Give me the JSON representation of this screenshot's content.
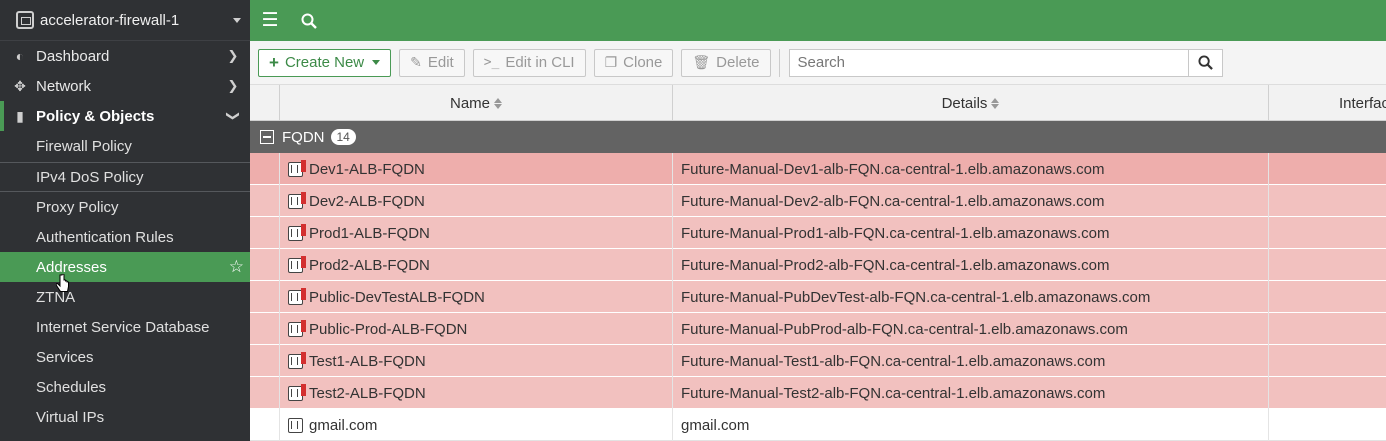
{
  "device": {
    "name": "accelerator-firewall-1"
  },
  "nav": [
    {
      "label": "Dashboard",
      "icon": "dashboard-icon"
    },
    {
      "label": "Network",
      "icon": "network-icon"
    },
    {
      "label": "Policy & Objects",
      "icon": "policy-icon"
    }
  ],
  "subnav": [
    {
      "label": "Firewall Policy"
    },
    {
      "label": "IPv4 DoS Policy"
    },
    {
      "label": "Proxy Policy"
    },
    {
      "label": "Authentication Rules"
    },
    {
      "label": "Addresses"
    },
    {
      "label": "ZTNA"
    },
    {
      "label": "Internet Service Database"
    },
    {
      "label": "Services"
    },
    {
      "label": "Schedules"
    },
    {
      "label": "Virtual IPs"
    }
  ],
  "toolbar": {
    "create_new": "Create New",
    "edit": "Edit",
    "edit_cli": "Edit in CLI",
    "clone": "Clone",
    "delete": "Delete",
    "search_placeholder": "Search"
  },
  "table": {
    "columns": [
      "Name",
      "Details",
      "Interfac"
    ],
    "group": {
      "label": "FQDN",
      "count": "14"
    },
    "rows": [
      {
        "name": "Dev1-ALB-FQDN",
        "details": "Future-Manual-Dev1-alb-FQN.ca-central-1.elb.amazonaws.com"
      },
      {
        "name": "Dev2-ALB-FQDN",
        "details": "Future-Manual-Dev2-alb-FQN.ca-central-1.elb.amazonaws.com"
      },
      {
        "name": "Prod1-ALB-FQDN",
        "details": "Future-Manual-Prod1-alb-FQN.ca-central-1.elb.amazonaws.com"
      },
      {
        "name": "Prod2-ALB-FQDN",
        "details": "Future-Manual-Prod2-alb-FQN.ca-central-1.elb.amazonaws.com"
      },
      {
        "name": "Public-DevTestALB-FQDN",
        "details": "Future-Manual-PubDevTest-alb-FQN.ca-central-1.elb.amazonaws.com"
      },
      {
        "name": "Public-Prod-ALB-FQDN",
        "details": "Future-Manual-PubProd-alb-FQN.ca-central-1.elb.amazonaws.com"
      },
      {
        "name": "Test1-ALB-FQDN",
        "details": "Future-Manual-Test1-alb-FQN.ca-central-1.elb.amazonaws.com"
      },
      {
        "name": "Test2-ALB-FQDN",
        "details": "Future-Manual-Test2-alb-FQN.ca-central-1.elb.amazonaws.com"
      },
      {
        "name": "gmail.com",
        "details": "gmail.com"
      }
    ]
  },
  "colors": {
    "accent_green": "#4a9a55",
    "sidebar_bg": "#2f3134",
    "row_warning": "#f2c1bf",
    "group_header": "#636363"
  }
}
